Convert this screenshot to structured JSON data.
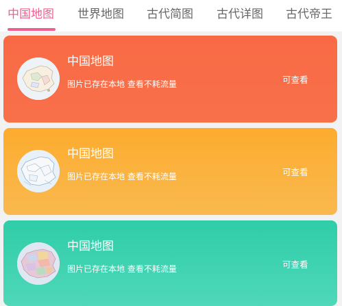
{
  "tabs": [
    {
      "label": "中国地图",
      "active": true
    },
    {
      "label": "世界地图",
      "active": false
    },
    {
      "label": "古代简图",
      "active": false
    },
    {
      "label": "古代详图",
      "active": false
    },
    {
      "label": "古代帝王",
      "active": false
    }
  ],
  "cards": [
    {
      "title": "中国地图",
      "subtitle": "图片已存在本地 查看不耗流量",
      "action": "可查看",
      "thumbnail": "china-map-thumbnail"
    },
    {
      "title": "中国地图",
      "subtitle": "图片已存在本地 查看不耗流量",
      "action": "可查看",
      "thumbnail": "china-map-thumbnail"
    },
    {
      "title": "中国地图",
      "subtitle": "图片已存在本地 查看不耗流量",
      "action": "可查看",
      "thumbnail": "china-map-thumbnail"
    }
  ],
  "colors": {
    "accent": "#ee5f8f",
    "card_1": "#f86a45",
    "card_2": "#fdac2e",
    "card_3": "#2fcda8"
  }
}
